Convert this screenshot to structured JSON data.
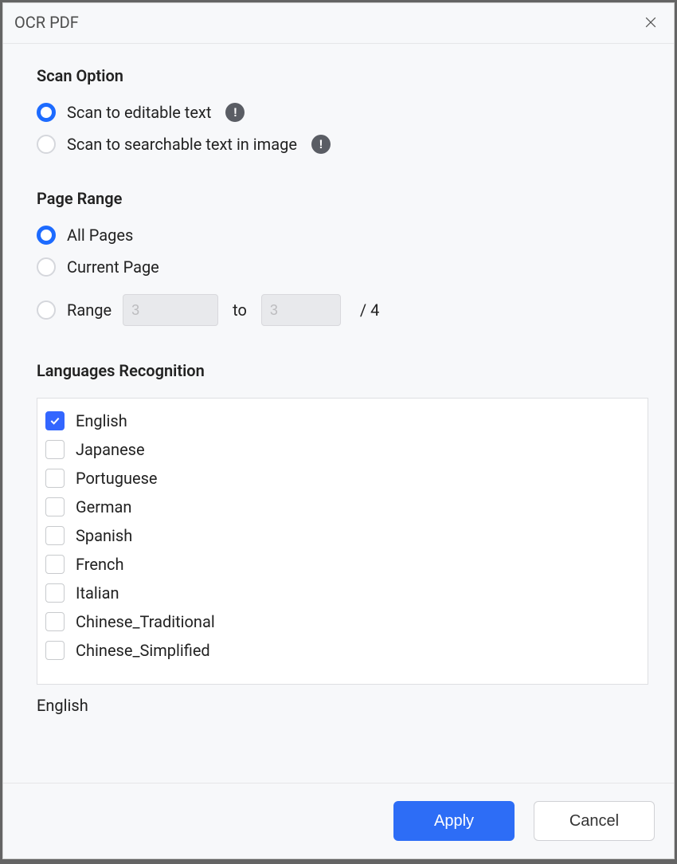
{
  "title": "OCR PDF",
  "sections": {
    "scan_option": {
      "heading": "Scan Option",
      "options": [
        {
          "label": "Scan to editable text",
          "selected": true,
          "info": "!"
        },
        {
          "label": "Scan to searchable text in image",
          "selected": false,
          "info": "!"
        }
      ]
    },
    "page_range": {
      "heading": "Page Range",
      "options": {
        "all": {
          "label": "All Pages",
          "selected": true
        },
        "current": {
          "label": "Current Page",
          "selected": false
        },
        "range": {
          "label": "Range",
          "selected": false,
          "from": "3",
          "to_text": "to",
          "to": "3",
          "total_prefix": "/ ",
          "total": "4"
        }
      }
    },
    "languages": {
      "heading": "Languages Recognition",
      "items": [
        {
          "label": "English",
          "checked": true
        },
        {
          "label": "Japanese",
          "checked": false
        },
        {
          "label": "Portuguese",
          "checked": false
        },
        {
          "label": "German",
          "checked": false
        },
        {
          "label": "Spanish",
          "checked": false
        },
        {
          "label": "French",
          "checked": false
        },
        {
          "label": "Italian",
          "checked": false
        },
        {
          "label": "Chinese_Traditional",
          "checked": false
        },
        {
          "label": "Chinese_Simplified",
          "checked": false
        }
      ],
      "selected_summary": "English"
    }
  },
  "footer": {
    "apply": "Apply",
    "cancel": "Cancel"
  }
}
